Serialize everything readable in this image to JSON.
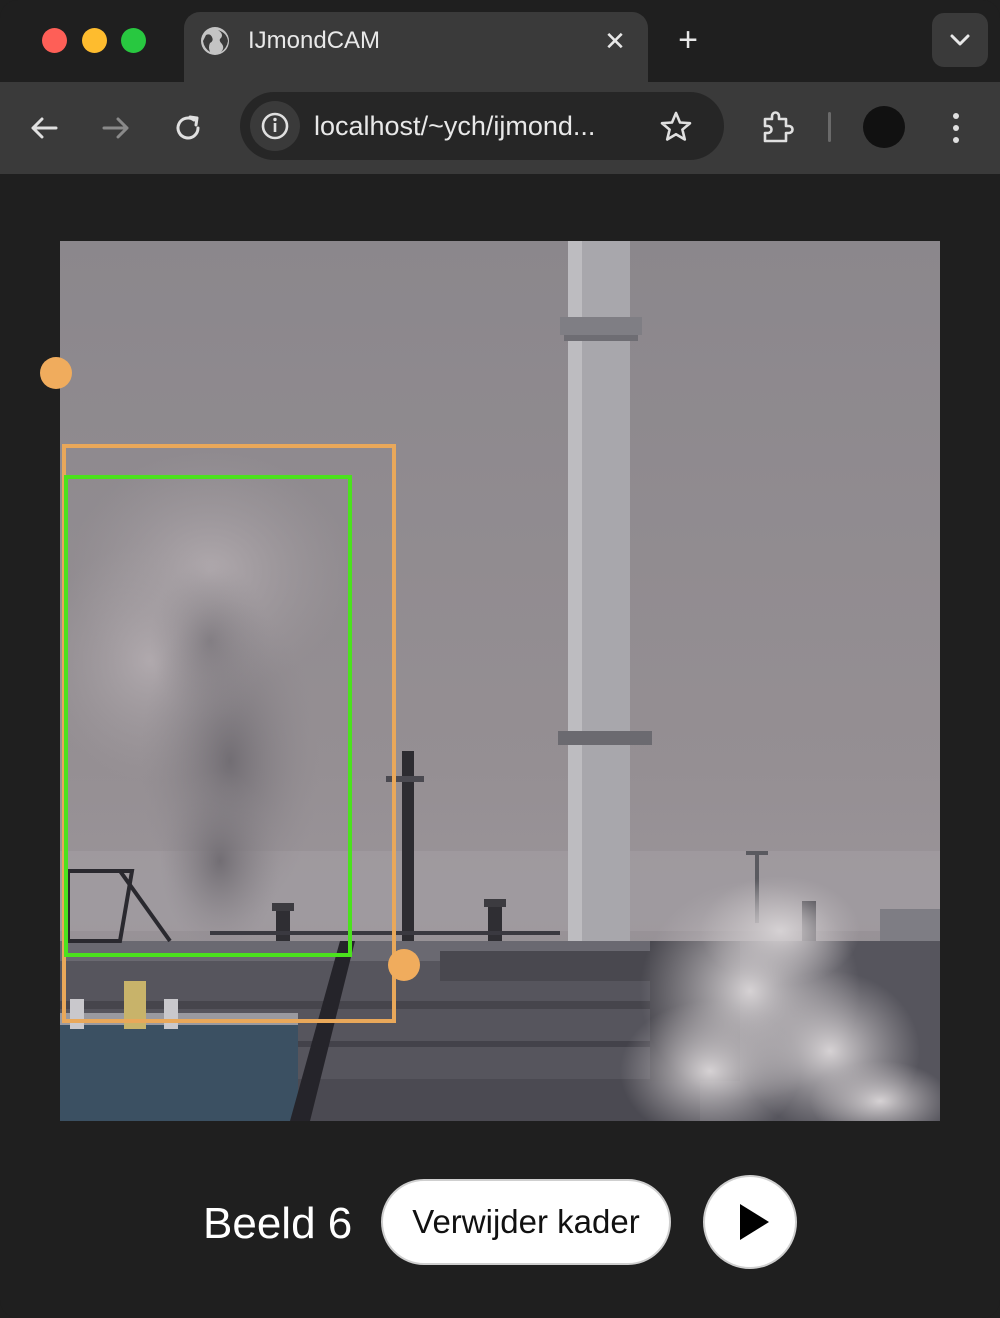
{
  "browser": {
    "tab": {
      "title": "IJmondCAM"
    },
    "omnibox": {
      "url": "localhost/~ych/ijmond..."
    }
  },
  "player": {
    "frame_label": "Beeld 6",
    "remove_label": "Verwijder kader"
  },
  "colors": {
    "box_outer": "#e9a85a",
    "box_inner": "#4be21d",
    "handle": "#f0ac5d"
  }
}
